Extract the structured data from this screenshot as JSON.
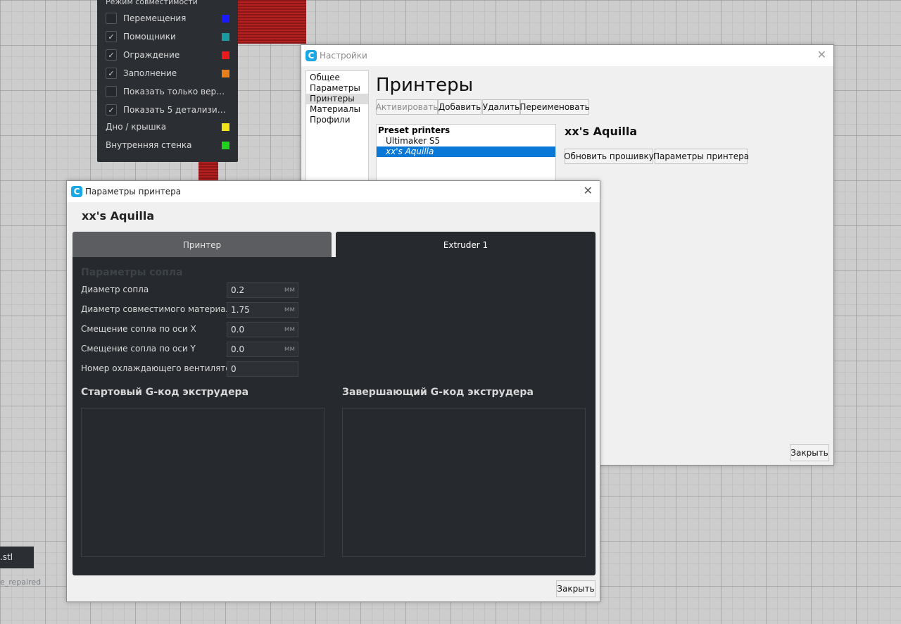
{
  "viewport": {
    "view_panel": {
      "mode_title": "Режим совместимости",
      "items": [
        {
          "label": "Перемещения",
          "checked": false,
          "color": "#1a1aff"
        },
        {
          "label": "Помощники",
          "checked": true,
          "color": "#1a9ba0"
        },
        {
          "label": "Ограждение",
          "checked": true,
          "color": "#e61c1c"
        },
        {
          "label": "Заполнение",
          "checked": true,
          "color": "#e6801c"
        },
        {
          "label": "Показать только верхние …",
          "checked": false,
          "color": null
        },
        {
          "label": "Показать 5 детализирова…",
          "checked": true,
          "color": null
        },
        {
          "label": "Дно / крышка",
          "checked": null,
          "color": "#f2e21a"
        },
        {
          "label": "Внутренняя стенка",
          "checked": null,
          "color": "#1fd31f"
        }
      ]
    },
    "file_badge": ".stl",
    "file_sub": "e_repaired",
    "model_color": "#b32020"
  },
  "prefs_window": {
    "title": "Настройки",
    "close_icon": "close-icon",
    "sidebar": [
      "Общее",
      "Параметры",
      "Принтеры",
      "Материалы",
      "Профили"
    ],
    "selected_sidebar": "Принтеры",
    "heading": "Принтеры",
    "buttons": {
      "activate": "Активировать",
      "add": "Добавить",
      "remove": "Удалить",
      "rename": "Переименовать"
    },
    "printer_list": {
      "header": "Preset printers",
      "items": [
        "Ultimaker S5",
        "xx's Aquilla"
      ],
      "selected": "xx's Aquilla"
    },
    "printer_name": "xx's Aquilla",
    "update_firmware": "Обновить прошивку",
    "machine_settings": "Параметры принтера",
    "close_button": "Закрыть"
  },
  "printer_settings_window": {
    "title": "Параметры принтера",
    "printer_name": "xx's Aquilla",
    "tabs": [
      "Принтер",
      "Extruder 1"
    ],
    "active_tab": "Extruder 1",
    "section_heading": "Параметры сопла",
    "fields": [
      {
        "label": "Диаметр сопла",
        "value": "0.2",
        "unit": "мм"
      },
      {
        "label": "Диаметр совместимого материала",
        "value": "1.75",
        "unit": "мм"
      },
      {
        "label": "Смещение сопла по оси X",
        "value": "0.0",
        "unit": "мм"
      },
      {
        "label": "Смещение сопла по оси Y",
        "value": "0.0",
        "unit": "мм"
      },
      {
        "label": "Номер охлаждающего вентилятора",
        "value": "0",
        "unit": ""
      }
    ],
    "start_gcode_title": "Стартовый G-код экструдера",
    "start_gcode": "",
    "end_gcode_title": "Завершающий G-код экструдера",
    "end_gcode": "",
    "close_button": "Закрыть"
  }
}
